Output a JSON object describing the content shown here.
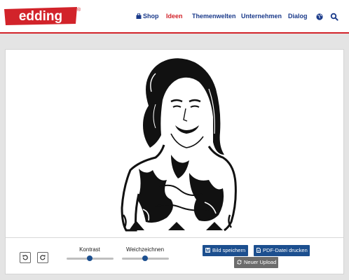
{
  "header": {
    "logo_text": "edding",
    "logo_mark": "®",
    "nav": [
      {
        "label": "Shop",
        "icon": "shopping-bag-icon"
      },
      {
        "label": "Ideen"
      },
      {
        "label": "Themenwelten"
      },
      {
        "label": "Unternehmen"
      },
      {
        "label": "Dialog"
      }
    ],
    "icons": [
      "globe-icon",
      "search-icon"
    ],
    "active_nav": "Ideen",
    "colors": {
      "brand_red": "#d2232a",
      "nav_blue": "#1a3a8a",
      "button_blue": "#1c4f8f",
      "button_grey": "#6c6c6c"
    }
  },
  "editor": {
    "rotate_left_icon": "rotate-left-icon",
    "rotate_right_icon": "rotate-right-icon",
    "sliders": [
      {
        "label": "Kontrast",
        "value": 0.5
      },
      {
        "label": "Weichzeichnen",
        "value": 0.5
      }
    ],
    "buttons": {
      "save": "Bild speichern",
      "print": "PDF-Datei drucken",
      "upload": "Neuer Upload"
    }
  }
}
